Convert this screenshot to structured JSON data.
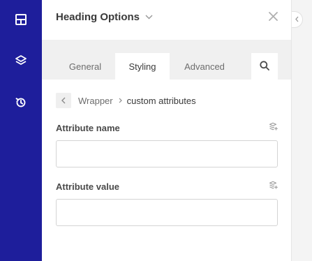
{
  "sidebar": {
    "items": [
      {
        "icon": "layout-grid-icon"
      },
      {
        "icon": "layers-icon"
      },
      {
        "icon": "history-icon"
      }
    ],
    "bg_color": "#1e1e9b"
  },
  "panel": {
    "title": "Heading Options",
    "tabs": [
      {
        "label": "General",
        "active": false
      },
      {
        "label": "Styling",
        "active": true
      },
      {
        "label": "Advanced",
        "active": false
      }
    ]
  },
  "breadcrumb": {
    "parent": "Wrapper",
    "current": "custom attributes"
  },
  "fields": {
    "attribute_name": {
      "label": "Attribute name",
      "value": ""
    },
    "attribute_value": {
      "label": "Attribute value",
      "value": ""
    }
  }
}
